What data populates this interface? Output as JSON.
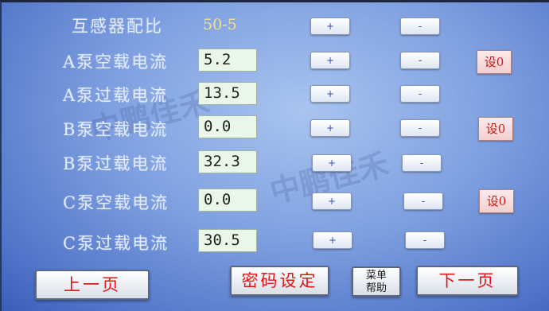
{
  "ratio_row": {
    "label": "互感器配比",
    "value": "50-5"
  },
  "rows": [
    {
      "label": "A泵空载电流",
      "value": "5.2",
      "set0": "设0"
    },
    {
      "label": "A泵过载电流",
      "value": "13.5"
    },
    {
      "label": "B泵空载电流",
      "value": "0.0",
      "set0": "设0"
    },
    {
      "label": "B泵过载电流",
      "value": "32.3"
    },
    {
      "label": "C泵空载电流",
      "value": "0.0",
      "set0": "设0"
    },
    {
      "label": "C泵过载电流",
      "value": "30.5"
    }
  ],
  "controls": {
    "plus": "+",
    "minus": "-"
  },
  "footer": {
    "prev": "上一页",
    "password": "密码设定",
    "help_line1": "菜单",
    "help_line2": "帮助",
    "next": "下一页"
  },
  "watermark": "中鹏佳禾"
}
